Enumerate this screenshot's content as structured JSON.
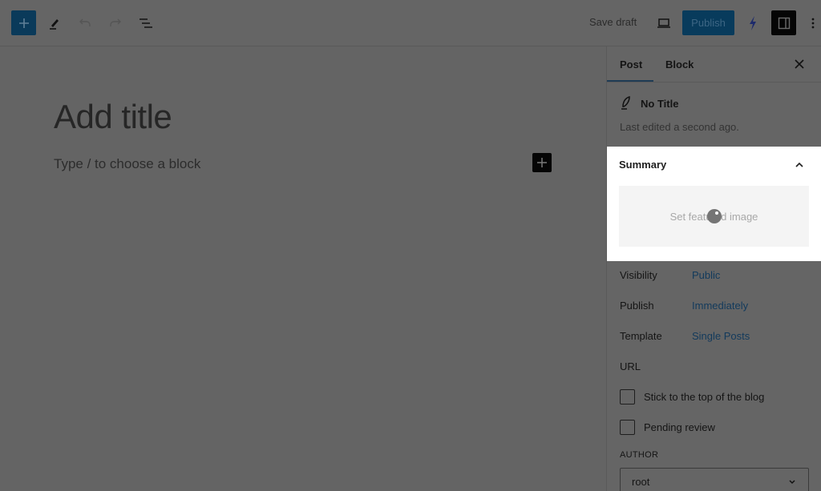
{
  "toolbar": {
    "inserter_label": "+",
    "icons": [
      "plus-icon",
      "pencil-tools-icon",
      "undo-icon",
      "redo-icon",
      "list-view-icon"
    ],
    "save_draft": "Save draft",
    "preview_icon": "laptop-icon",
    "publish": "Publish",
    "plugin_icon": "lightning-icon",
    "settings_icon": "sidebar-toggle-icon",
    "options_icon": "more-vertical-icon"
  },
  "editor": {
    "title_placeholder": "Add title",
    "block_placeholder": "Type / to choose a block"
  },
  "sidebar": {
    "tabs": [
      {
        "label": "Post",
        "active": true
      },
      {
        "label": "Block",
        "active": false
      }
    ],
    "post_title": "No Title",
    "last_edited": "Last edited a second ago.",
    "summary": {
      "title": "Summary",
      "expanded": true,
      "featured_image_label": "Set featured image",
      "loading": true
    },
    "fields": [
      {
        "label": "Visibility",
        "value": "Public"
      },
      {
        "label": "Publish",
        "value": "Immediately"
      },
      {
        "label": "Template",
        "value": "Single Posts"
      },
      {
        "label": "URL",
        "value": ""
      }
    ],
    "checkboxes": [
      {
        "label": "Stick to the top of the blog",
        "checked": false
      },
      {
        "label": "Pending review",
        "checked": false
      }
    ],
    "author": {
      "label": "AUTHOR",
      "selected": "root"
    }
  }
}
